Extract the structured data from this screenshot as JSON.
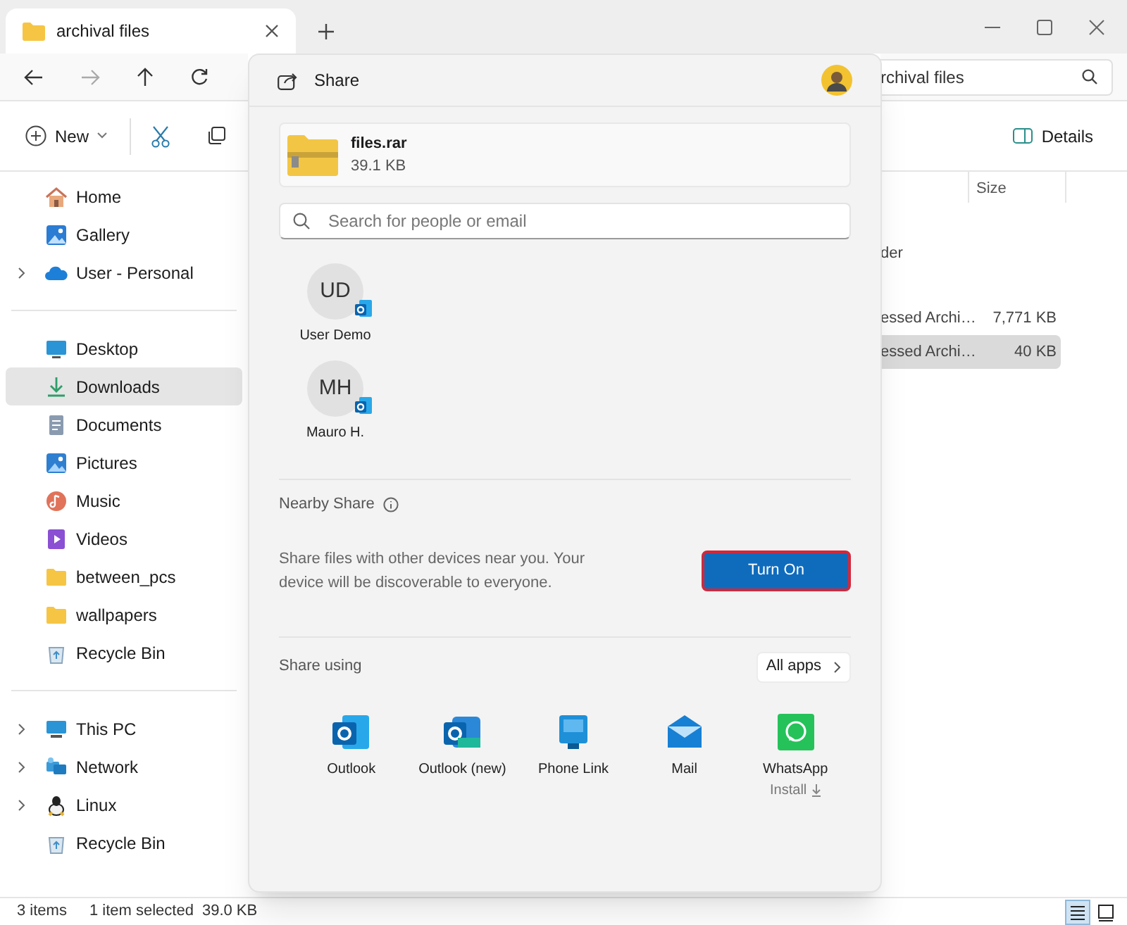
{
  "window": {
    "tab_title": "archival files"
  },
  "toolbar": {
    "new_label": "New",
    "details_label": "Details"
  },
  "address": {
    "value": "rchival files"
  },
  "sidebar": {
    "sections": [
      {
        "items": [
          {
            "label": "Home",
            "expandable": false,
            "selected": false
          },
          {
            "label": "Gallery",
            "expandable": false,
            "selected": false
          },
          {
            "label": "User - Personal",
            "expandable": true,
            "selected": false
          }
        ]
      },
      {
        "items": [
          {
            "label": "Desktop",
            "expandable": false,
            "selected": false
          },
          {
            "label": "Downloads",
            "expandable": false,
            "selected": true
          },
          {
            "label": "Documents",
            "expandable": false,
            "selected": false
          },
          {
            "label": "Pictures",
            "expandable": false,
            "selected": false
          },
          {
            "label": "Music",
            "expandable": false,
            "selected": false
          },
          {
            "label": "Videos",
            "expandable": false,
            "selected": false
          },
          {
            "label": "between_pcs",
            "expandable": false,
            "selected": false
          },
          {
            "label": "wallpapers",
            "expandable": false,
            "selected": false
          },
          {
            "label": "Recycle Bin",
            "expandable": false,
            "selected": false
          }
        ]
      },
      {
        "items": [
          {
            "label": "This PC",
            "expandable": true,
            "selected": false
          },
          {
            "label": "Network",
            "expandable": true,
            "selected": false
          },
          {
            "label": "Linux",
            "expandable": true,
            "selected": false
          },
          {
            "label": "Recycle Bin",
            "expandable": false,
            "selected": false
          }
        ]
      }
    ]
  },
  "file_list": {
    "columns": [
      "Size"
    ],
    "rows": [
      {
        "column_3": "der",
        "selected": false
      },
      {
        "column_3": "essed Archi…",
        "size": "7,771 KB",
        "selected": false
      },
      {
        "column_3": "essed Archi…",
        "size": "40 KB",
        "selected": true
      }
    ]
  },
  "share_dialog": {
    "title": "Share",
    "file": {
      "name": "files.rar",
      "size": "39.1 KB"
    },
    "search": {
      "placeholder": "Search for people or email"
    },
    "contacts": [
      {
        "initials": "UD",
        "name": "User Demo"
      },
      {
        "initials": "MH",
        "name": "Mauro H."
      }
    ],
    "nearby_share": {
      "title": "Nearby Share",
      "description": "Share files with other devices near you. Your device will be discoverable to everyone.",
      "button": "Turn On"
    },
    "share_using": {
      "title": "Share using",
      "all_apps": "All apps",
      "apps": [
        {
          "name": "Outlook"
        },
        {
          "name": "Outlook (new)"
        },
        {
          "name": "Phone Link"
        },
        {
          "name": "Mail"
        },
        {
          "name": "WhatsApp",
          "note": "Install"
        }
      ]
    }
  },
  "status_bar": {
    "item_count": "3 items",
    "selection": "1 item selected",
    "size": "39.0 KB",
    "views": [
      {
        "selected": true
      },
      {
        "selected": false
      }
    ]
  }
}
